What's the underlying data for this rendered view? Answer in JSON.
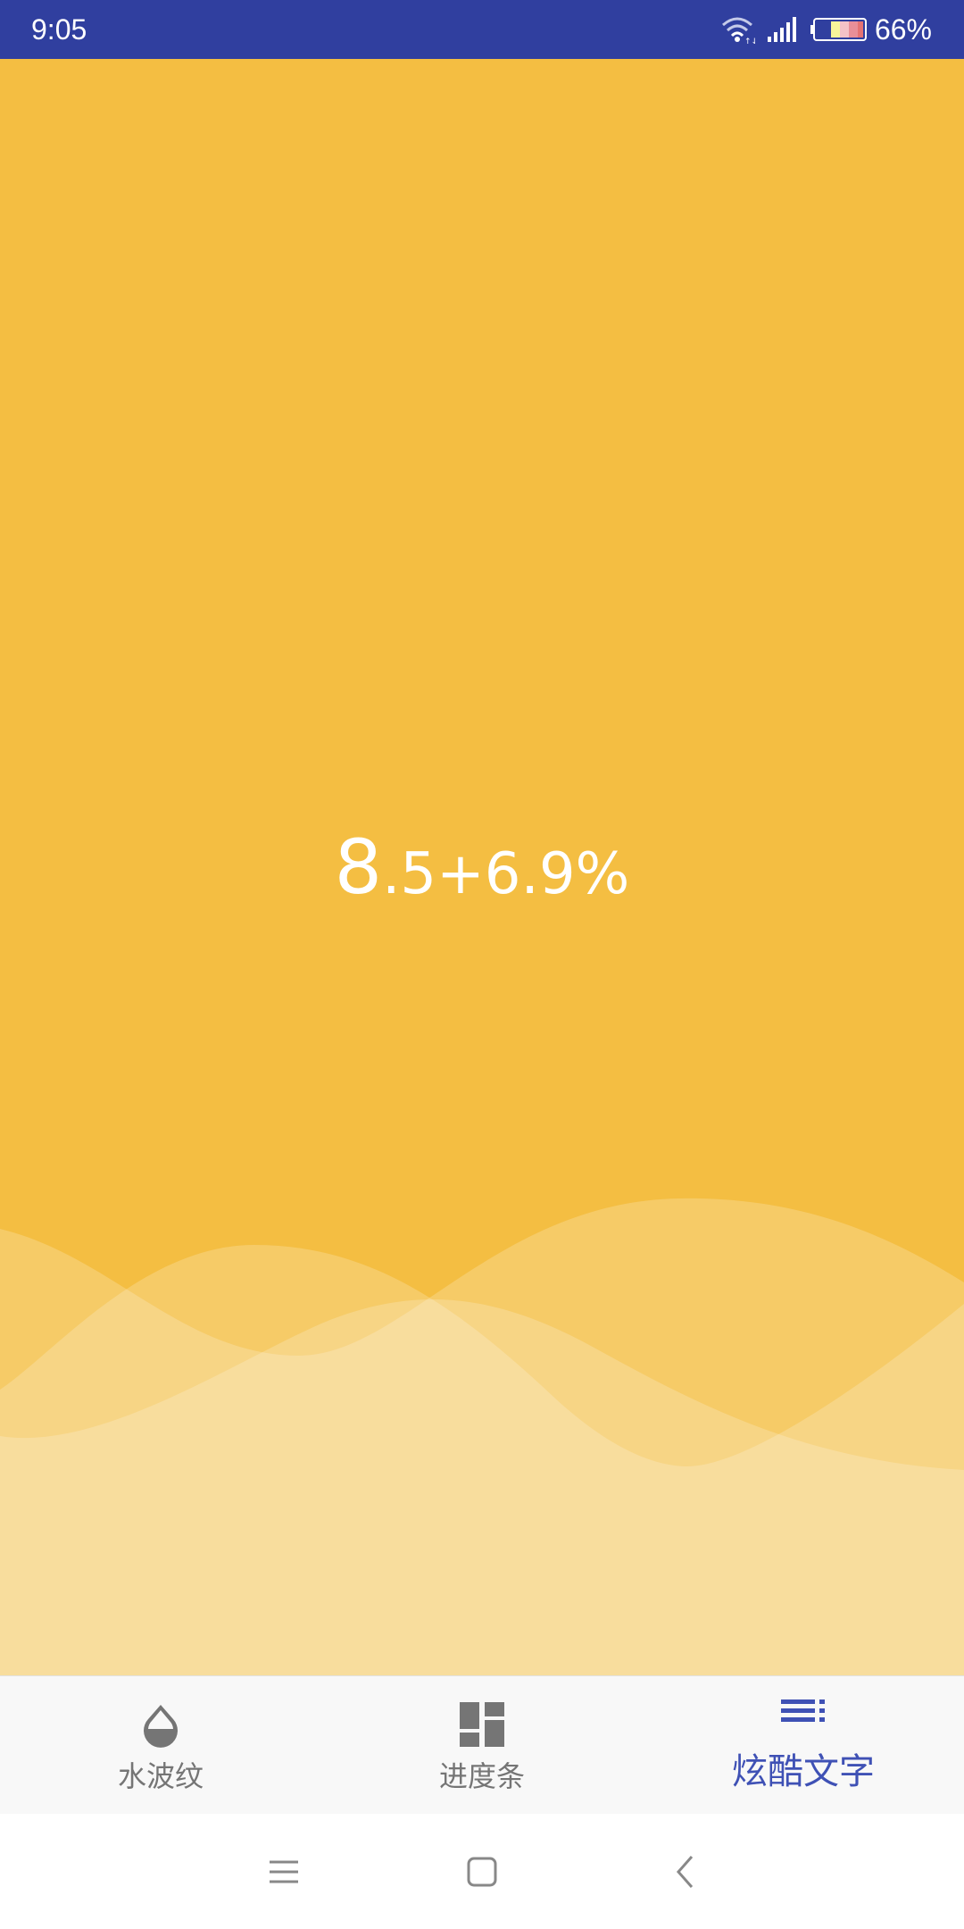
{
  "status_bar": {
    "time": "9:05",
    "battery": "66%",
    "background": "#303F9F"
  },
  "main": {
    "background": "#F4BE42",
    "big_digit": "8",
    "value_text": ".5+6.9%"
  },
  "bottom_nav": {
    "items": [
      {
        "label": "水波纹",
        "icon": "water-drop-icon",
        "active": false
      },
      {
        "label": "进度条",
        "icon": "dashboard-icon",
        "active": false
      },
      {
        "label": "炫酷文字",
        "icon": "text-list-icon",
        "active": true
      }
    ],
    "active_color": "#3F51B5",
    "inactive_color": "#757575"
  },
  "system_nav": {
    "buttons": [
      "menu-icon",
      "home-icon",
      "back-icon"
    ]
  }
}
